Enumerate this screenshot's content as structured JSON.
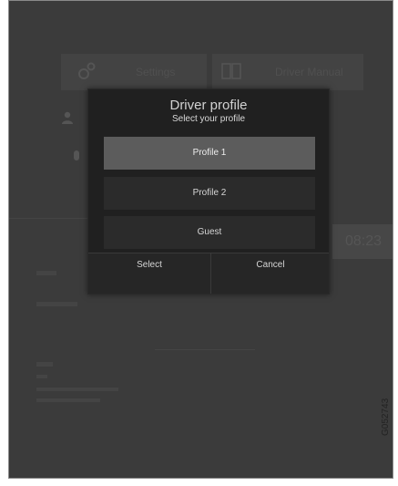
{
  "background": {
    "tiles": [
      {
        "label": "Settings",
        "icon": "gear-icon"
      },
      {
        "label": "Driver Manual",
        "icon": "book-icon"
      }
    ],
    "clock": "08:23"
  },
  "dialog": {
    "title": "Driver profile",
    "subtitle": "Select your profile",
    "options": [
      {
        "label": "Profile 1",
        "selected": true
      },
      {
        "label": "Profile 2",
        "selected": false
      },
      {
        "label": "Guest",
        "selected": false
      }
    ],
    "select_label": "Select",
    "cancel_label": "Cancel"
  },
  "image_code": "G052743",
  "colors": {
    "screen_bg": "#3b3b3b",
    "dialog_bg": "#202020",
    "selected_option": "#5c5c5c"
  }
}
